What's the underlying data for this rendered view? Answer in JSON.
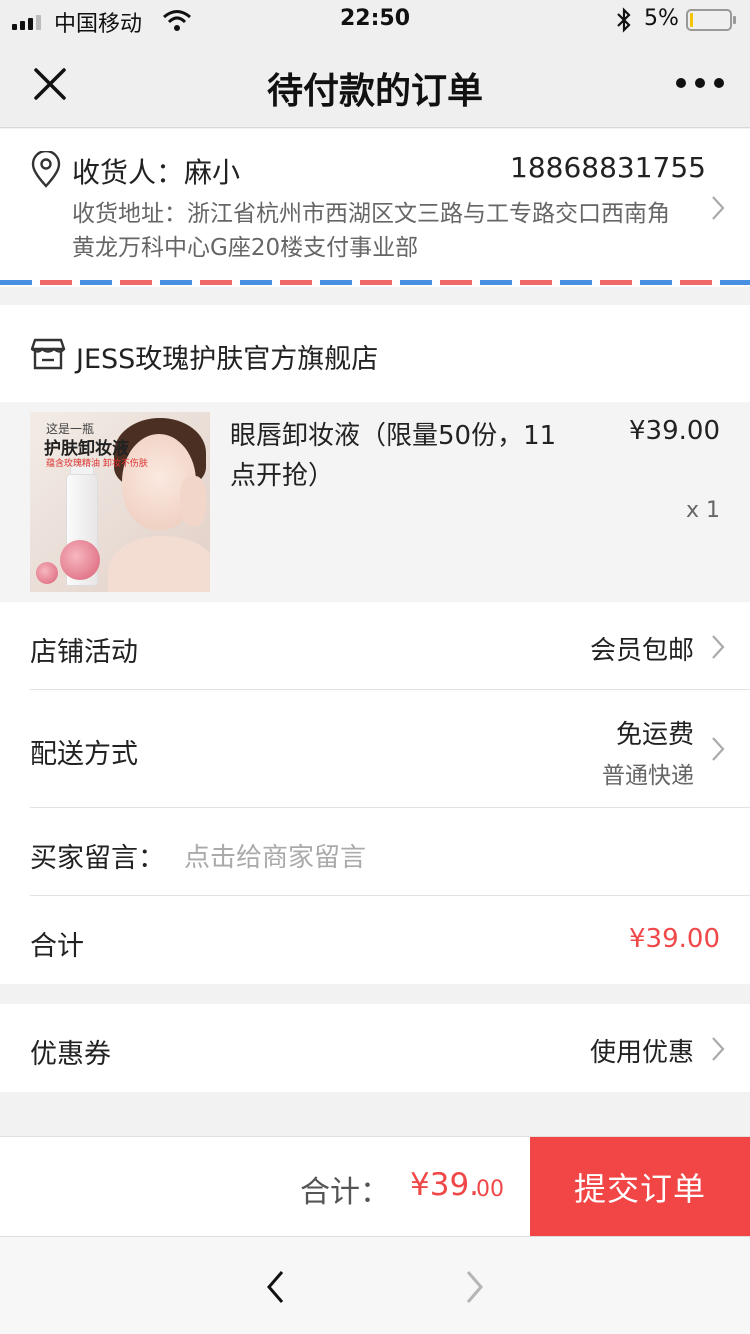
{
  "status_bar": {
    "carrier": "中国移动",
    "time": "22:50",
    "battery_percent": "5%",
    "battery_level": 0.05
  },
  "nav": {
    "title": "待付款的订单"
  },
  "address": {
    "receiver": "收货人：麻小",
    "phone": "18868831755",
    "address_line": "收货地址：浙江省杭州市西湖区文三路与工专路交口西南角 黄龙万科中心G座20楼支付事业部"
  },
  "shop": {
    "name": "JESS玫瑰护肤官方旗舰店"
  },
  "product": {
    "title": "眼唇卸妆液（限量50份，11点开抢）",
    "price": "¥39.00",
    "quantity": "x 1",
    "image_text": {
      "line1": "这是一瓶",
      "line2": "护肤卸妆液",
      "line3": "蕴含玫瑰精油  卸妆不伤肤"
    }
  },
  "rows": {
    "activity": {
      "label": "店铺活动",
      "value": "会员包邮"
    },
    "delivery": {
      "label": "配送方式",
      "value": "免运费",
      "sub": "普通快递"
    },
    "note": {
      "label": "买家留言：",
      "placeholder": "点击给商家留言"
    },
    "subtotal": {
      "label": "合计",
      "value": "¥39.00"
    },
    "coupon": {
      "label": "优惠券",
      "value": "使用优惠"
    }
  },
  "footer": {
    "total_label": "合计：",
    "total_main": "¥39.",
    "total_cents": "00",
    "submit_label": "提交订单"
  },
  "colors": {
    "accent_red": "#f24646",
    "stripe_blue": "#4a90e2",
    "stripe_red": "#f06a6a"
  },
  "icons": [
    "close-icon",
    "more-icon",
    "location-pin-icon",
    "chevron-right-icon",
    "shop-icon",
    "back-arrow-icon",
    "forward-arrow-icon"
  ]
}
